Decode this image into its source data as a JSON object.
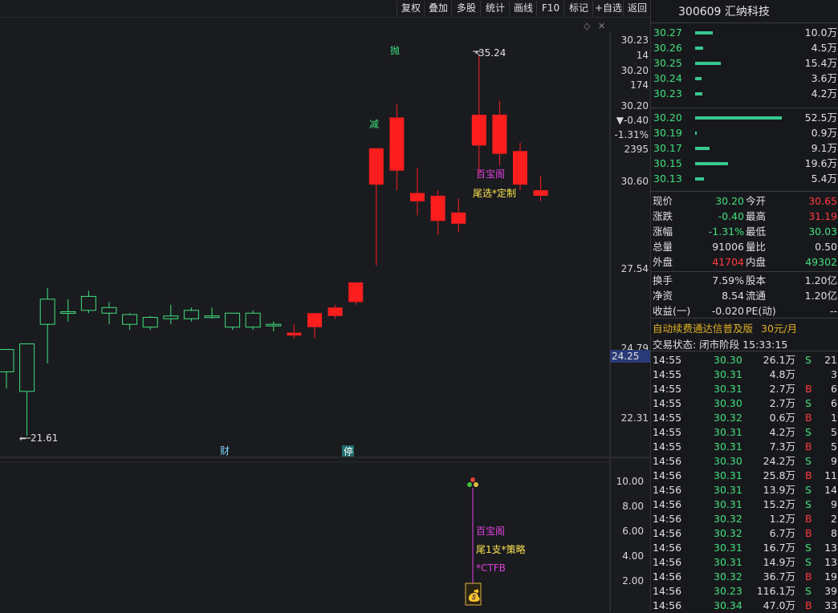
{
  "toolbar": {
    "buttons": [
      "复权",
      "叠加",
      "多股",
      "统计",
      "画线",
      "F10",
      "标记",
      "+自选",
      "返回"
    ]
  },
  "stock": {
    "code_name": "300609 汇纳科技"
  },
  "chart_labels": {
    "high_marker": "35.24",
    "low_marker": "21.61",
    "sell_label": "抛",
    "reduce_label": "减",
    "baobao_label": "百宝阁",
    "tail_label": "尾选*定制",
    "cai_label": "财",
    "ting_label": "停"
  },
  "price_axis": {
    "top_price": "30.23",
    "top_vol": "14",
    "p2": "30.20",
    "p2_vol": "174",
    "p3": "30.20",
    "change": "▼-0.40",
    "change_pct": "-1.31%",
    "vol": "2395",
    "t1": "30.60",
    "t2": "27.54",
    "t3": "24.79",
    "current_tag": "24.25",
    "t4": "22.31"
  },
  "lower_axis": [
    "10.00",
    "8.00",
    "6.00",
    "4.00",
    "2.00"
  ],
  "lower_labels": {
    "baobao": "百宝阁",
    "strategy": "尾1支*策略",
    "ctfb": "*CTFB"
  },
  "asks": [
    {
      "price": "30.27",
      "vol": "10.0万",
      "bar": 0.2
    },
    {
      "price": "30.26",
      "vol": "4.5万",
      "bar": 0.09
    },
    {
      "price": "30.25",
      "vol": "15.4万",
      "bar": 0.3
    },
    {
      "price": "30.24",
      "vol": "3.6万",
      "bar": 0.07
    },
    {
      "price": "30.23",
      "vol": "4.2万",
      "bar": 0.08
    }
  ],
  "bids": [
    {
      "price": "30.20",
      "vol": "52.5万",
      "bar": 1.0
    },
    {
      "price": "30.19",
      "vol": "0.9万",
      "bar": 0.02
    },
    {
      "price": "30.17",
      "vol": "9.1万",
      "bar": 0.17
    },
    {
      "price": "30.15",
      "vol": "19.6万",
      "bar": 0.38
    },
    {
      "price": "30.13",
      "vol": "5.4万",
      "bar": 0.1
    }
  ],
  "quote": {
    "now_label": "现价",
    "now": "30.20",
    "open_label": "今开",
    "open": "30.65",
    "chg_label": "涨跌",
    "chg": "-0.40",
    "high_label": "最高",
    "high": "31.19",
    "pct_label": "涨幅",
    "pct": "-1.31%",
    "low_label": "最低",
    "low": "30.03",
    "vol_label": "总量",
    "vol": "91006",
    "ratio_label": "量比",
    "ratio": "0.50",
    "out_label": "外盘",
    "out": "41704",
    "in_label": "内盘",
    "in": "49302",
    "turn_label": "换手",
    "turn": "7.59%",
    "cap_label": "股本",
    "cap": "1.20亿",
    "nav_label": "净资",
    "nav": "8.54",
    "float_label": "流通",
    "float": "1.20亿",
    "eps_label": "收益(一)",
    "eps": "-0.020",
    "pe_label": "PE(动)",
    "pe": "--"
  },
  "promo": {
    "text": "自动续费通达信普及版",
    "price": "30元/月"
  },
  "status": {
    "text": "交易状态: 闭市阶段 15:33:15"
  },
  "ticks": [
    {
      "time": "14:55",
      "price": "30.30",
      "vol": "26.1万",
      "side": "S",
      "n": "21"
    },
    {
      "time": "14:55",
      "price": "30.31",
      "vol": "4.8万",
      "side": "",
      "n": "3"
    },
    {
      "time": "14:55",
      "price": "30.31",
      "vol": "2.7万",
      "side": "B",
      "n": "6"
    },
    {
      "time": "14:55",
      "price": "30.30",
      "vol": "2.7万",
      "side": "S",
      "n": "6"
    },
    {
      "time": "14:55",
      "price": "30.32",
      "vol": "0.6万",
      "side": "B",
      "n": "1"
    },
    {
      "time": "14:55",
      "price": "30.31",
      "vol": "4.2万",
      "side": "S",
      "n": "5"
    },
    {
      "time": "14:55",
      "price": "30.31",
      "vol": "7.3万",
      "side": "B",
      "n": "5"
    },
    {
      "time": "14:56",
      "price": "30.30",
      "vol": "24.2万",
      "side": "S",
      "n": "9"
    },
    {
      "time": "14:56",
      "price": "30.31",
      "vol": "25.8万",
      "side": "B",
      "n": "11"
    },
    {
      "time": "14:56",
      "price": "30.31",
      "vol": "13.9万",
      "side": "S",
      "n": "14"
    },
    {
      "time": "14:56",
      "price": "30.31",
      "vol": "15.2万",
      "side": "S",
      "n": "9"
    },
    {
      "time": "14:56",
      "price": "30.32",
      "vol": "1.2万",
      "side": "B",
      "n": "2"
    },
    {
      "time": "14:56",
      "price": "30.32",
      "vol": "6.7万",
      "side": "B",
      "n": "8"
    },
    {
      "time": "14:56",
      "price": "30.31",
      "vol": "16.7万",
      "side": "S",
      "n": "13"
    },
    {
      "time": "14:56",
      "price": "30.31",
      "vol": "14.9万",
      "side": "S",
      "n": "13"
    },
    {
      "time": "14:56",
      "price": "30.32",
      "vol": "36.7万",
      "side": "B",
      "n": "19"
    },
    {
      "time": "14:56",
      "price": "30.23",
      "vol": "116.1万",
      "side": "S",
      "n": "39"
    },
    {
      "time": "14:56",
      "price": "30.34",
      "vol": "47.0万",
      "side": "B",
      "n": "33"
    }
  ],
  "chart_data": {
    "type": "candlestick",
    "candles": [
      {
        "o": 23.9,
        "h": 24.6,
        "l": 23.3,
        "c": 24.7
      },
      {
        "o": 23.2,
        "h": 24.9,
        "l": 21.61,
        "c": 24.9
      },
      {
        "o": 25.6,
        "h": 26.9,
        "l": 24.2,
        "c": 26.5
      },
      {
        "o": 26.0,
        "h": 26.5,
        "l": 25.7,
        "c": 26.05
      },
      {
        "o": 26.1,
        "h": 26.8,
        "l": 26.0,
        "c": 26.6
      },
      {
        "o": 26.0,
        "h": 26.4,
        "l": 25.6,
        "c": 26.2
      },
      {
        "o": 25.6,
        "h": 26.0,
        "l": 25.4,
        "c": 25.95
      },
      {
        "o": 25.5,
        "h": 25.9,
        "l": 25.4,
        "c": 25.85
      },
      {
        "o": 25.8,
        "h": 26.3,
        "l": 25.6,
        "c": 25.9
      },
      {
        "o": 25.8,
        "h": 26.2,
        "l": 25.7,
        "c": 26.1
      },
      {
        "o": 25.9,
        "h": 26.2,
        "l": 25.8,
        "c": 25.9
      },
      {
        "o": 25.5,
        "h": 26.0,
        "l": 25.4,
        "c": 26.0
      },
      {
        "o": 25.5,
        "h": 26.1,
        "l": 25.4,
        "c": 26.0
      },
      {
        "o": 25.6,
        "h": 25.7,
        "l": 25.35,
        "c": 25.55
      },
      {
        "o": 25.2,
        "h": 25.6,
        "l": 25.1,
        "c": 25.3
      },
      {
        "o": 25.5,
        "h": 25.9,
        "l": 25.1,
        "c": 26.0
      },
      {
        "o": 25.9,
        "h": 26.3,
        "l": 25.8,
        "c": 26.2
      },
      {
        "o": 26.4,
        "h": 27.1,
        "l": 26.3,
        "c": 27.1
      },
      {
        "o": 30.6,
        "h": 30.7,
        "l": 27.7,
        "c": 31.9
      },
      {
        "o": 31.1,
        "h": 33.5,
        "l": 30.4,
        "c": 33.0
      },
      {
        "o": 30.3,
        "h": 31.2,
        "l": 29.5,
        "c": 30.0
      },
      {
        "o": 30.2,
        "h": 30.4,
        "l": 28.8,
        "c": 29.3
      },
      {
        "o": 29.6,
        "h": 30.1,
        "l": 28.9,
        "c": 29.2
      },
      {
        "o": 33.1,
        "h": 35.24,
        "l": 31.0,
        "c": 32.0
      },
      {
        "o": 33.1,
        "h": 33.6,
        "l": 31.3,
        "c": 31.7
      },
      {
        "o": 31.8,
        "h": 32.1,
        "l": 30.4,
        "c": 30.6
      },
      {
        "o": 30.4,
        "h": 30.9,
        "l": 30.0,
        "c": 30.2
      }
    ]
  }
}
